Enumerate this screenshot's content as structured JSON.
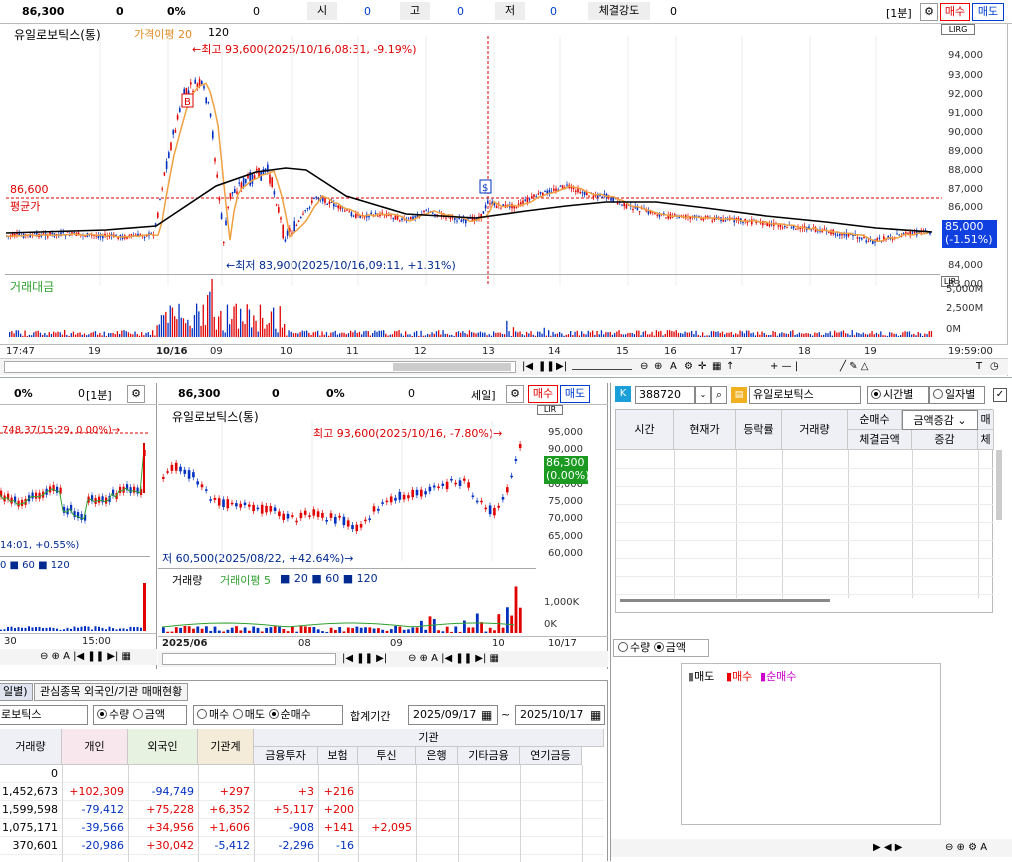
{
  "top": {
    "price": "86,300",
    "chg": "0",
    "pct": "0%",
    "vol": "0",
    "open_lbl": "시",
    "open": "0",
    "high_lbl": "고",
    "high": "0",
    "low_lbl": "저",
    "low": "0",
    "strength_lbl": "체결강도",
    "strength": "0",
    "period": "[1분]",
    "buy": "매수",
    "sell": "매도"
  },
  "main": {
    "name": "유일로보틱스(통)",
    "ma_lbl": "가격이평 20",
    "ma2": "120",
    "hi_note": "←최고 93,600(2025/10/16,08:31, -9.19%)",
    "lo_note": "←최저 83,900(2025/10/16,09:11, +1.31%)",
    "avg_price": "86,600",
    "avg_lbl": "평균가",
    "cur_price": "85,000",
    "cur_pct": "(-1.51%)",
    "vol_lbl": "거래대금",
    "lir": "LIR",
    "lirg": "LIRG",
    "yticks": [
      "94,000",
      "93,000",
      "92,000",
      "91,000",
      "90,000",
      "89,000",
      "88,000",
      "87,000",
      "86,000",
      "84,000",
      "83,000"
    ],
    "vticks": [
      "5,000M",
      "2,500M",
      "0M"
    ],
    "xticks": [
      "17:47",
      "19",
      "10/16",
      "09",
      "10",
      "11",
      "12",
      "13",
      "14",
      "15",
      "16",
      "17",
      "18",
      "19",
      "19:59:00"
    ]
  },
  "left": {
    "pct": "0%",
    "v": "0",
    "period": "[1분]",
    "note": "748.37(15:29, 0.00%)→",
    "note2": "14:01, +0.55%)",
    "leg": "0  ■ 60  ■ 120",
    "x1": "30",
    "x2": "15:00"
  },
  "mid": {
    "price": "86,300",
    "chg": "0",
    "pct": "0%",
    "v": "0",
    "period": "세일]",
    "buy": "매수",
    "sell": "매도",
    "name": "유일로보틱스(통)",
    "hi_note": "최고 93,600(2025/10/16, -7.80%)→",
    "lo_note": "저 60,500(2025/08/22, +42.64%)→",
    "cur": "86,300",
    "cur_pct": "(0.00%)",
    "yticks": [
      "95,000",
      "90,000",
      "80,000",
      "75,000",
      "70,000",
      "65,000",
      "60,000"
    ],
    "vol_lbl": "거래량",
    "vol_ma": "거래이평 5",
    "vol_leg": "■ 20  ■ 60  ■ 120",
    "vticks": [
      "1,000K",
      "0K"
    ],
    "xticks": [
      "2025/06",
      "08",
      "09",
      "10",
      "10/17"
    ]
  },
  "right": {
    "code": "388720",
    "name": "유일로보틱스",
    "opt1": "시간별",
    "opt2": "일자별",
    "sort": "금액증감",
    "headers": [
      "시간",
      "현재가",
      "등락률",
      "거래량",
      "순매수",
      "체결금액",
      "증감",
      "매",
      "체"
    ],
    "radio1": "수량",
    "radio2": "금액",
    "legend": [
      "매도",
      "매수",
      "순매수"
    ]
  },
  "bottom": {
    "tab1": "일별)",
    "tab2": "관심종목 외국인/기관 매매현황",
    "name": "로보틱스",
    "r1": "수량",
    "r2": "금액",
    "r3": "매수",
    "r4": "매도",
    "r5": "순매수",
    "period_lbl": "합계기간",
    "from": "2025/09/17",
    "tilde": "~",
    "to": "2025/10/17",
    "headers": [
      "거래량",
      "개인",
      "외국인",
      "기관계",
      "기관",
      "금융투자",
      "보험",
      "투신",
      "은행",
      "기타금융",
      "연기금등"
    ],
    "rows": [
      [
        "0",
        "",
        "",
        "",
        "",
        "",
        "",
        ""
      ],
      [
        "1,452,673",
        "+102,309",
        "-94,749",
        "+297",
        "+3",
        "+216",
        "",
        ""
      ],
      [
        "1,599,598",
        "-79,412",
        "+75,228",
        "+6,352",
        "+5,117",
        "+200",
        "",
        ""
      ],
      [
        "1,075,171",
        "-39,566",
        "+34,956",
        "+1,606",
        "-908",
        "+141",
        "+2,095",
        ""
      ],
      [
        "370,601",
        "-20,986",
        "+30,042",
        "-5,412",
        "-2,296",
        "-16",
        "",
        ""
      ]
    ]
  },
  "colors": {
    "up": "#e00000",
    "down": "#0030c0",
    "ma20": "#f0a040",
    "ma120": "#000000",
    "volma": "#30a030"
  }
}
